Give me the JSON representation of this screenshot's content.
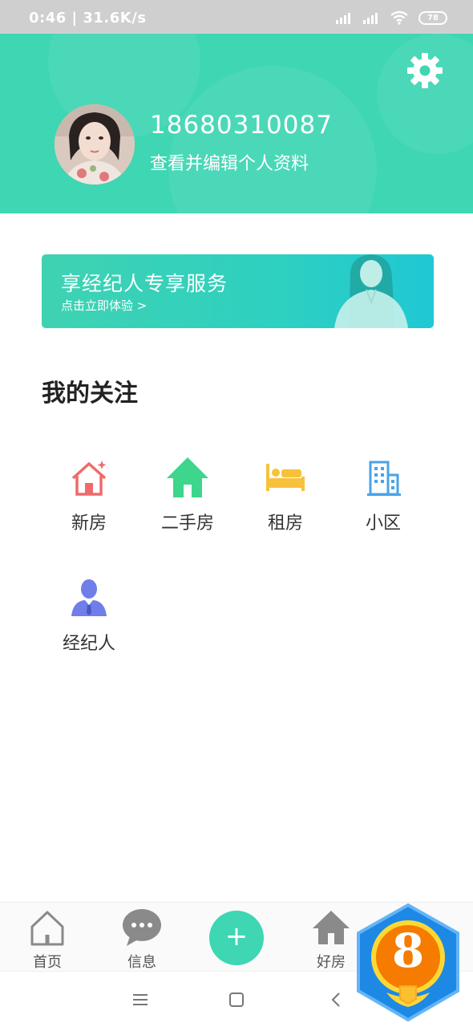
{
  "status_bar": {
    "time_speed": "0:46 | 31.6K/s",
    "battery": "78"
  },
  "profile": {
    "phone": "18680310087",
    "edit_text": "查看并编辑个人资料"
  },
  "banner": {
    "title": "享经纪人专享服务",
    "subtitle": "点击立即体验 >"
  },
  "section": {
    "title": "我的关注"
  },
  "categories": [
    {
      "label": "新房",
      "icon": "new-house-icon",
      "color": "#f06a6a"
    },
    {
      "label": "二手房",
      "icon": "house-icon",
      "color": "#3dd68c"
    },
    {
      "label": "租房",
      "icon": "bed-icon",
      "color": "#f7c23b"
    },
    {
      "label": "小区",
      "icon": "building-icon",
      "color": "#4aa3e8"
    },
    {
      "label": "经纪人",
      "icon": "agent-icon",
      "color": "#6f7ee8"
    }
  ],
  "bottom_nav": [
    {
      "label": "首页",
      "icon": "home-outline-icon"
    },
    {
      "label": "信息",
      "icon": "chat-bubble-icon"
    },
    {
      "label": "",
      "icon": "plus-icon"
    },
    {
      "label": "好房",
      "icon": "house-filled-icon"
    }
  ],
  "fab_symbol": "+",
  "badge": {
    "number": "8"
  },
  "colors": {
    "accent": "#3ed6b3",
    "status_bar": "#cfcfcf"
  }
}
